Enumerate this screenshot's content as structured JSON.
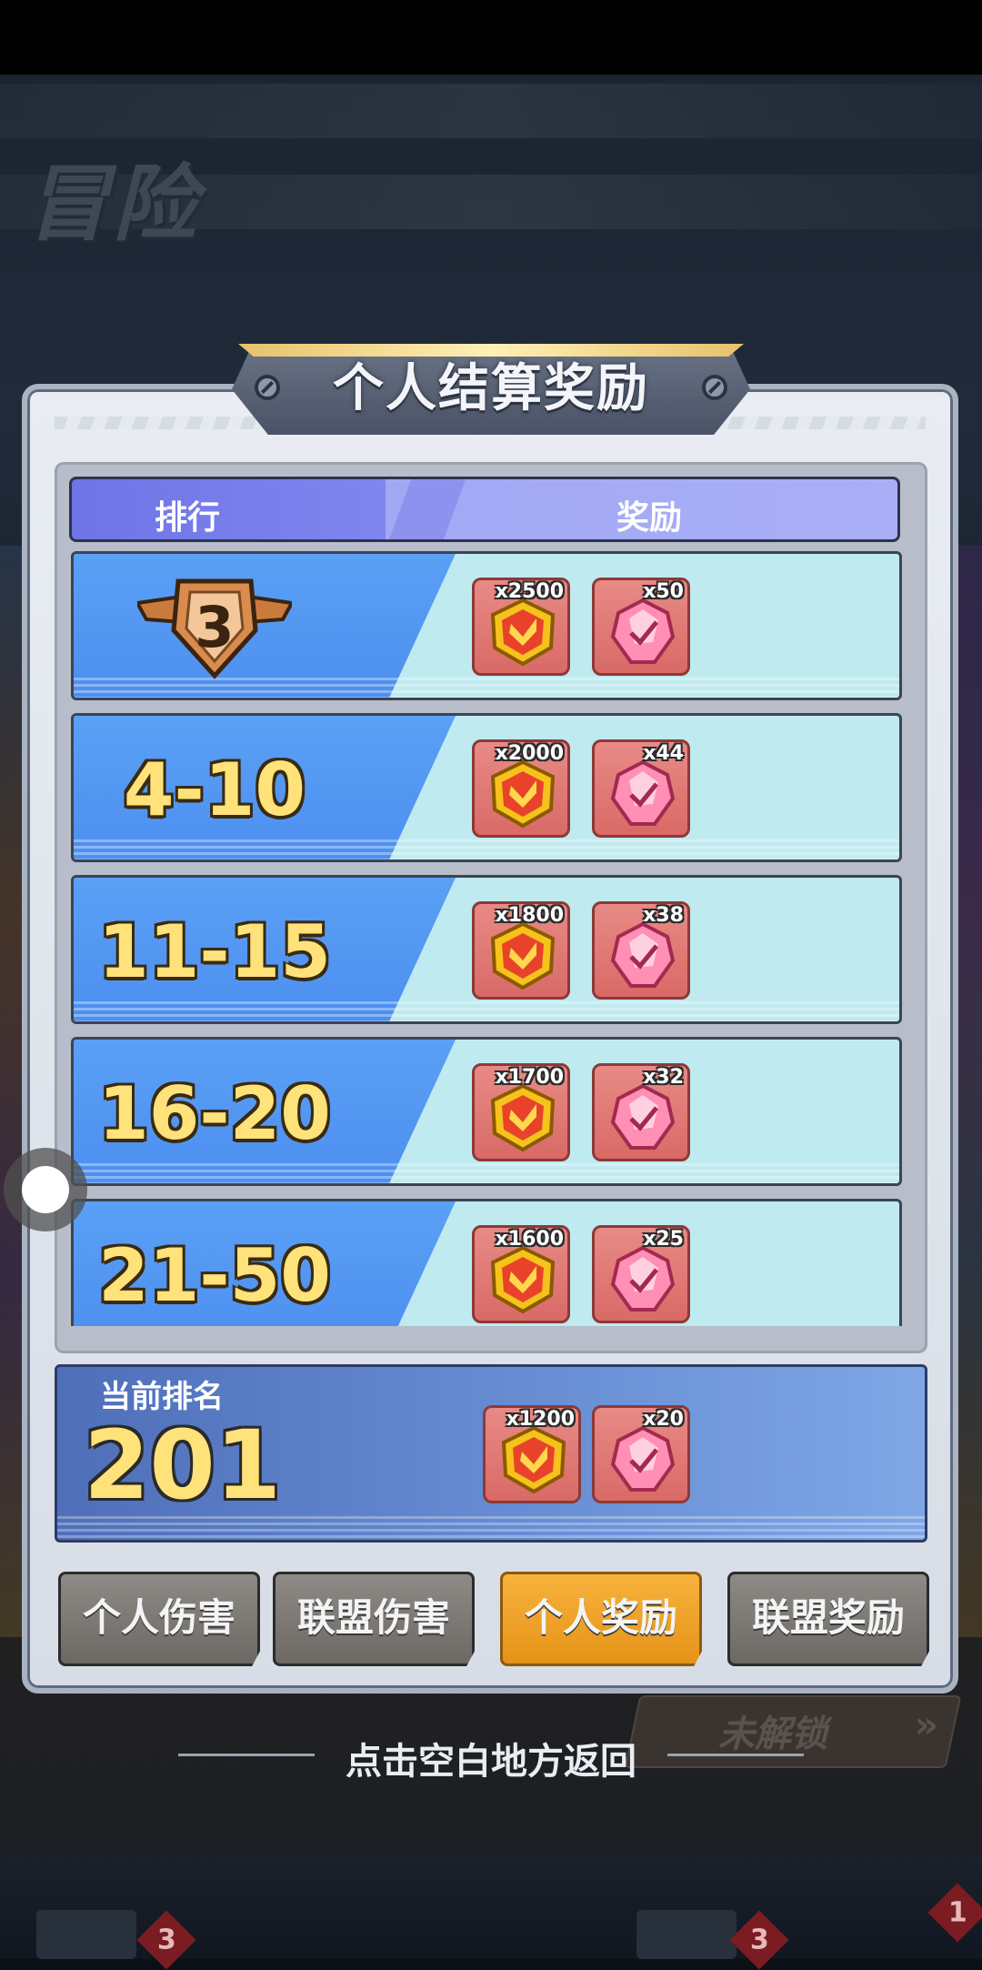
{
  "background": {
    "scene_title": "冒险",
    "locked_label": "未解锁",
    "locked_arrow": "»",
    "bottom_badges": [
      "3",
      "3",
      "1"
    ]
  },
  "dialog": {
    "title": "个人结算奖励",
    "header": {
      "rank": "排行",
      "reward": "奖励"
    },
    "rows": [
      {
        "rank": "3",
        "rank_icon": "bronze-medal-3",
        "rewards": [
          {
            "icon": "gold-shield-coin",
            "qty": "x2500"
          },
          {
            "icon": "pink-crystal",
            "qty": "x50"
          }
        ]
      },
      {
        "rank": "4-10",
        "rewards": [
          {
            "icon": "gold-shield-coin",
            "qty": "x2000"
          },
          {
            "icon": "pink-crystal",
            "qty": "x44"
          }
        ]
      },
      {
        "rank": "11-15",
        "rewards": [
          {
            "icon": "gold-shield-coin",
            "qty": "x1800"
          },
          {
            "icon": "pink-crystal",
            "qty": "x38"
          }
        ]
      },
      {
        "rank": "16-20",
        "rewards": [
          {
            "icon": "gold-shield-coin",
            "qty": "x1700"
          },
          {
            "icon": "pink-crystal",
            "qty": "x32"
          }
        ]
      },
      {
        "rank": "21-50",
        "rewards": [
          {
            "icon": "gold-shield-coin",
            "qty": "x1600"
          },
          {
            "icon": "pink-crystal",
            "qty": "x25"
          }
        ]
      }
    ],
    "current": {
      "label": "当前排名",
      "value": "201",
      "rewards": [
        {
          "icon": "gold-shield-coin",
          "qty": "x1200"
        },
        {
          "icon": "pink-crystal",
          "qty": "x20"
        }
      ]
    },
    "tabs": [
      {
        "label": "个人伤害",
        "active": false
      },
      {
        "label": "联盟伤害",
        "active": false
      },
      {
        "label": "个人奖励",
        "active": true
      },
      {
        "label": "联盟奖励",
        "active": false
      }
    ]
  },
  "back_hint": "点击空白地方返回",
  "colors": {
    "rank_text": "#ffe27a",
    "tab_active": "#f0a42a",
    "tab_inactive": "#7d7975",
    "header_purple": "#7f86ee",
    "row_blue": "#5aa0f5",
    "row_cyan": "#bfeaf0"
  }
}
